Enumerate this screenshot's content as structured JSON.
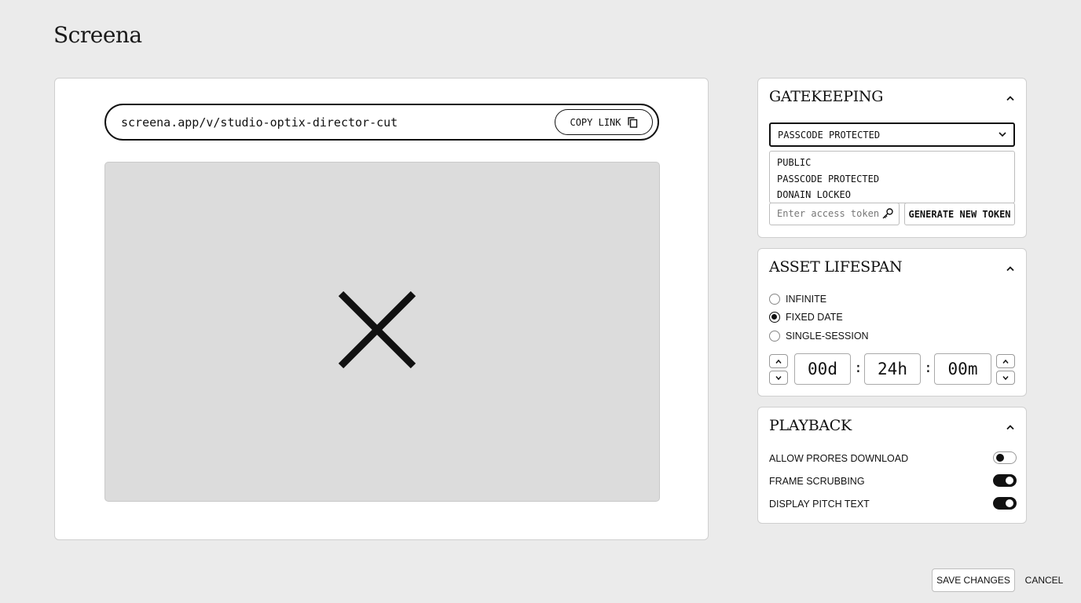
{
  "app": {
    "title": "Screena"
  },
  "preview": {
    "url": "screena.app/v/studio-optix-director-cut",
    "copy_label": "COPY LINK",
    "media_icon": "broken-media-x-icon"
  },
  "gatekeeping": {
    "title": "GATEKEEPING",
    "selected_mode": "PASSCODE PROTECTED",
    "options": [
      "PUBLIC",
      "PASSCODE PROTECTED",
      "DONAIN LOCKEO"
    ],
    "token_placeholder": "Enter access token",
    "generate_label": "GENERATE NEW TOKEN"
  },
  "lifespan": {
    "title": "ASSET LIFESPAN",
    "options": [
      {
        "label": "INFINITE",
        "selected": false
      },
      {
        "label": "FIXED DATE",
        "selected": true
      },
      {
        "label": "SINGLE-SESSION",
        "selected": false
      }
    ],
    "days": "00d",
    "hours": "24h",
    "minutes": "00m",
    "separator": ":"
  },
  "playback": {
    "title": "PLAYBACK",
    "toggles": [
      {
        "label": "ALLOW PRORES DOWNLOAD",
        "on": false
      },
      {
        "label": "FRAME SCRUBBING",
        "on": true
      },
      {
        "label": "DISPLAY PITCH TEXT",
        "on": true
      }
    ]
  },
  "footer": {
    "save_label": "SAVE CHANGES",
    "cancel_label": "CANCEL"
  }
}
